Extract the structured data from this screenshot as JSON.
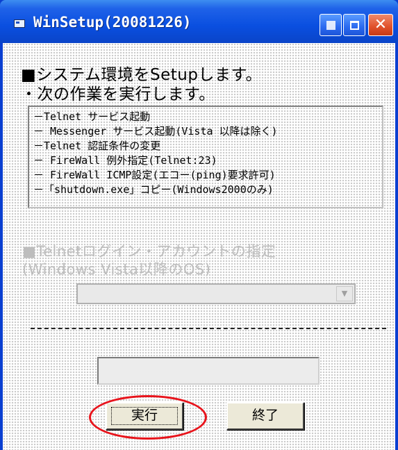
{
  "window": {
    "title": "WinSetup(20081226)",
    "minimize_icon": "minimize-icon",
    "maximize_icon": "maximize-icon",
    "close_glyph": "✕"
  },
  "intro": {
    "line1": "■システム環境をSetupします。",
    "line2": "・次の作業を実行します。"
  },
  "tasks": [
    "－Telnet サービス起動",
    "－ Messenger サービス起動(Vista 以降は除く)",
    "－Telnet 認証条件の変更",
    "－ FireWall 例外指定(Telnet:23)",
    "－ FireWall ICMP設定(エコー(ping)要求許可)",
    "－「shutdown.exe」コピー(Windows2000のみ)"
  ],
  "login": {
    "label1": "■Telnetログイン・アカウントの指定",
    "label2": " (Windows Vista以降のOS)",
    "account_value": "",
    "arrow": "▼"
  },
  "status": {
    "value": ""
  },
  "buttons": {
    "run": "実行",
    "exit": "終了"
  },
  "colors": {
    "titlebar": "#0a4fe0",
    "client_bg": "#ffffff",
    "disabled_text": "#bdbdbd",
    "highlight_ring": "#e8131b",
    "button_face": "#ece9d8"
  }
}
